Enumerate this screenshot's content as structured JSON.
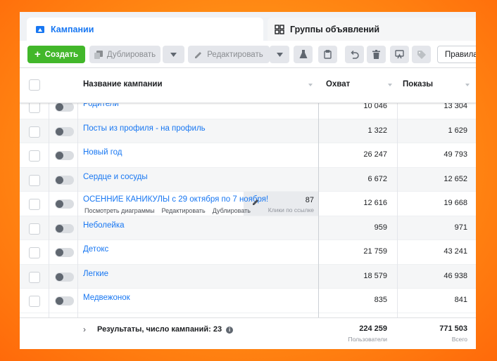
{
  "tabs": {
    "campaigns": "Кампании",
    "adsets": "Группы объявлений"
  },
  "toolbar": {
    "create": "Создать",
    "duplicate": "Дублировать",
    "edit": "Редактировать",
    "rules": "Правила"
  },
  "table": {
    "headers": {
      "name": "Название кампании",
      "reach": "Охват",
      "impressions": "Показы"
    },
    "rows": [
      {
        "name": "Родители",
        "reach": "10 046",
        "impressions": "13 304"
      },
      {
        "name": "Посты из профиля - на профиль",
        "reach": "1 322",
        "impressions": "1 629"
      },
      {
        "name": "Новый год",
        "reach": "26 247",
        "impressions": "49 793"
      },
      {
        "name": "Сердце и сосуды",
        "reach": "6 672",
        "impressions": "12 652"
      },
      {
        "name": "ОСЕННИЕ КАНИКУЛЫ с 29 октября по 7 ноября!",
        "reach": "12 616",
        "impressions": "19 668"
      },
      {
        "name": "Неболейка",
        "reach": "959",
        "impressions": "971"
      },
      {
        "name": "Детокс",
        "reach": "21 759",
        "impressions": "43 241"
      },
      {
        "name": "Легкие",
        "reach": "18 579",
        "impressions": "46 938"
      },
      {
        "name": "Медвежонок",
        "reach": "835",
        "impressions": "841"
      }
    ],
    "hover_actions": {
      "charts": "Посмотреть диаграммы",
      "edit": "Редактировать",
      "duplicate": "Дублировать"
    },
    "hover_clicks": {
      "value": "87",
      "label": "Клики по ссылке"
    },
    "footer": {
      "label": "Результаты, число кампаний: 23",
      "reach_total": "224 259",
      "reach_sub": "Пользователи",
      "impressions_total": "771 503",
      "impressions_sub": "Всего"
    }
  },
  "colors": {
    "accent": "#1877f2",
    "create": "#42b72a",
    "background": "#ff8a14"
  }
}
